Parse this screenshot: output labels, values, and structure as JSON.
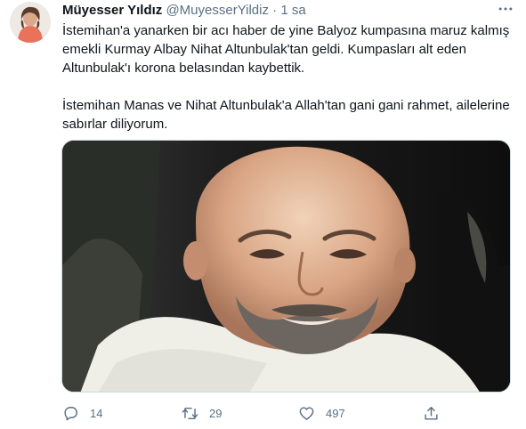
{
  "tweet": {
    "author_name": "Müyesser Yıldız",
    "author_handle": "@MuyesserYildiz",
    "separator": "·",
    "time": "1 sa",
    "more_icon": "more-options-icon",
    "text_paragraph_1": "İstemihan'a yanarken bir acı haber de yine Balyoz kumpasına maruz kalmış emekli Kurmay Albay Nihat Altunbulak'tan geldi. Kumpasları alt eden Altunbulak'ı korona belasından kaybettik.",
    "text_paragraph_2": "İstemihan Manas ve Nihat Altunbulak'a Allah'tan gani gani rahmet, ailelerine sabırlar diliyorum."
  },
  "actions": {
    "reply_count": "14",
    "retweet_count": "29",
    "like_count": "497",
    "icons": [
      "reply-icon",
      "retweet-icon",
      "like-icon",
      "share-icon"
    ]
  },
  "colors": {
    "text": "#0f1419",
    "secondary": "#5b7083",
    "border": "#cfd9de"
  }
}
